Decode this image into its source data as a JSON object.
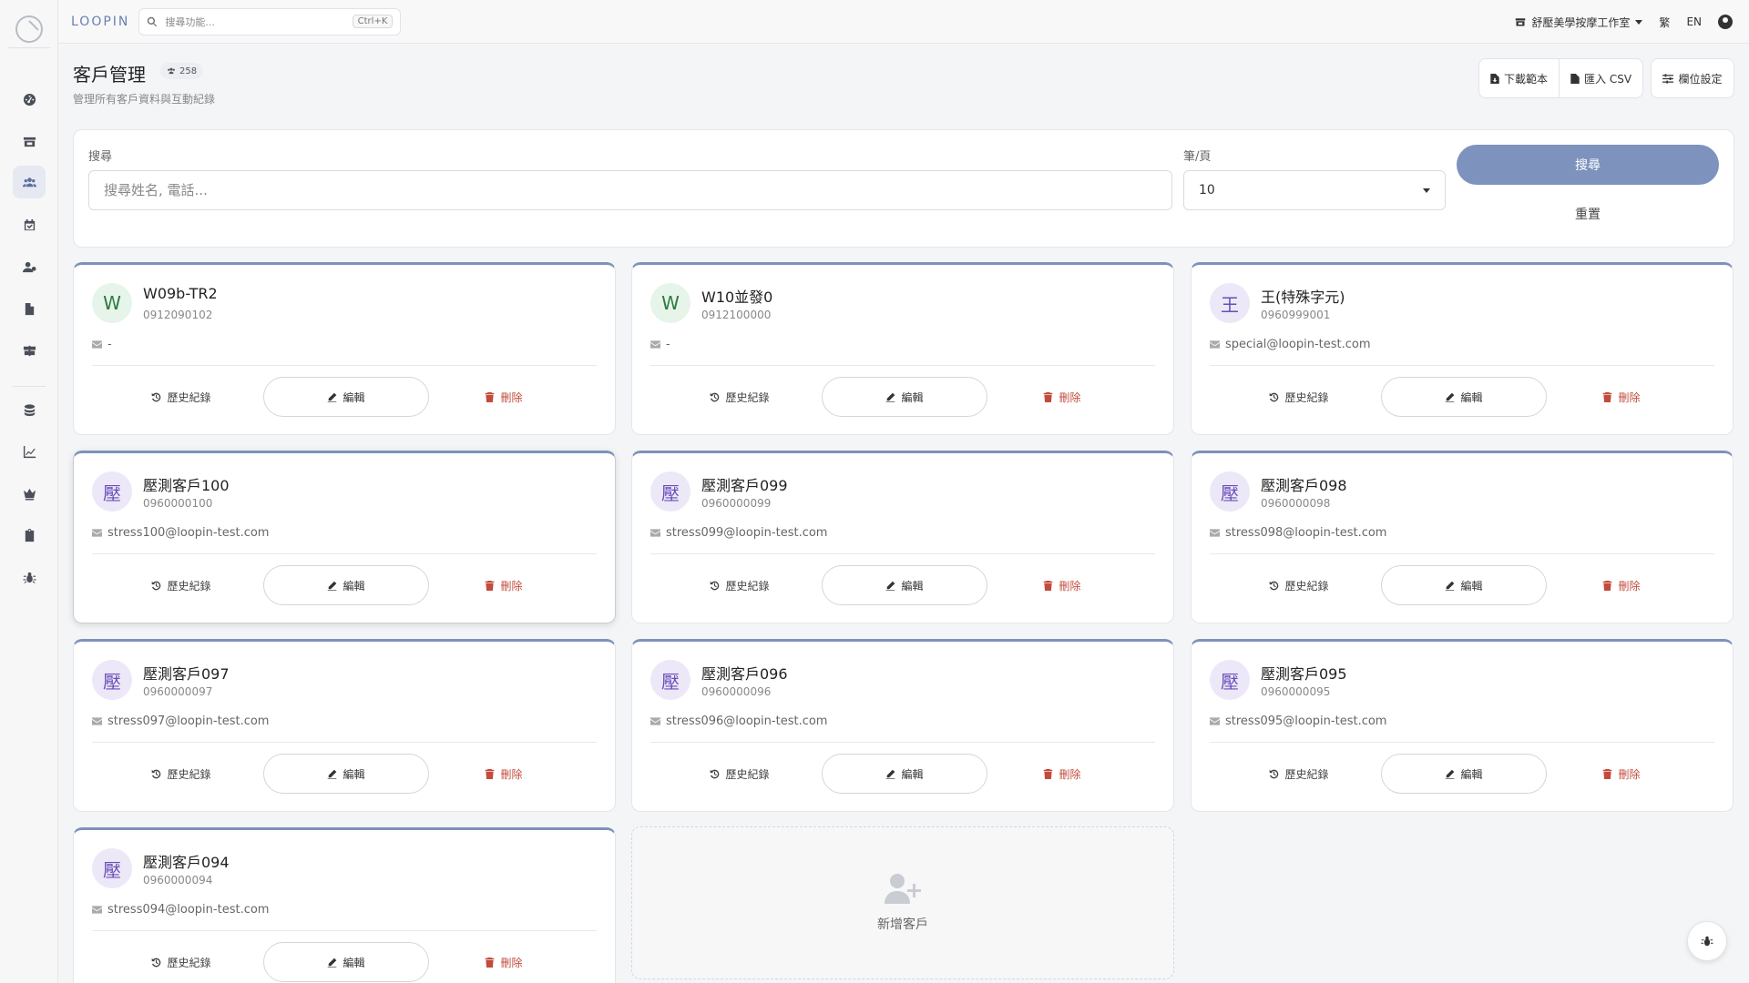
{
  "topbar": {
    "brand": "LOOPIN",
    "search_placeholder": "搜尋功能...",
    "shortcut": "Ctrl+K",
    "shop_name": "舒壓美學按摩工作室",
    "lang_zh": "繁",
    "lang_en": "EN"
  },
  "sidebar": {
    "items": [
      "dashboard-icon",
      "store-icon",
      "customers-icon",
      "calendar-icon",
      "staff-icon",
      "document-icon",
      "services-icon",
      "coins-icon",
      "chart-icon",
      "crown-icon",
      "clipboard-icon",
      "bug-icon"
    ],
    "active": "customers-icon"
  },
  "header": {
    "title": "客戶管理",
    "count": "258",
    "subtitle": "管理所有客戶資料與互動紀錄",
    "download_template": "下載範本",
    "import_csv": "匯入 CSV",
    "column_settings": "欄位設定"
  },
  "search": {
    "search_label": "搜尋",
    "search_placeholder": "搜尋姓名, 電話...",
    "per_page_label": "筆/頁",
    "per_page_value": "10",
    "search_button": "搜尋",
    "reset_button": "重置"
  },
  "card_actions": {
    "history": "歷史紀錄",
    "edit": "編輯",
    "delete": "刪除"
  },
  "customers": [
    {
      "initial": "W",
      "name": "W09b-TR2",
      "phone": "0912090102",
      "email": "-",
      "color": "green"
    },
    {
      "initial": "W",
      "name": "W10並發0",
      "phone": "0912100000",
      "email": "-",
      "color": "green"
    },
    {
      "initial": "王",
      "name": "王(特殊字元)",
      "phone": "0960999001",
      "email": "special@loopin-test.com",
      "color": "purple"
    },
    {
      "initial": "壓",
      "name": "壓測客戶100",
      "phone": "0960000100",
      "email": "stress100@loopin-test.com",
      "color": "purple"
    },
    {
      "initial": "壓",
      "name": "壓測客戶099",
      "phone": "0960000099",
      "email": "stress099@loopin-test.com",
      "color": "purple"
    },
    {
      "initial": "壓",
      "name": "壓測客戶098",
      "phone": "0960000098",
      "email": "stress098@loopin-test.com",
      "color": "purple"
    },
    {
      "initial": "壓",
      "name": "壓測客戶097",
      "phone": "0960000097",
      "email": "stress097@loopin-test.com",
      "color": "purple"
    },
    {
      "initial": "壓",
      "name": "壓測客戶096",
      "phone": "0960000096",
      "email": "stress096@loopin-test.com",
      "color": "purple"
    },
    {
      "initial": "壓",
      "name": "壓測客戶095",
      "phone": "0960000095",
      "email": "stress095@loopin-test.com",
      "color": "purple"
    },
    {
      "initial": "壓",
      "name": "壓測客戶094",
      "phone": "0960000094",
      "email": "stress094@loopin-test.com",
      "color": "purple"
    }
  ],
  "add_card": {
    "label": "新增客戶"
  },
  "colors": {
    "accent": "#7d92bd",
    "delete": "#c24b3b"
  }
}
